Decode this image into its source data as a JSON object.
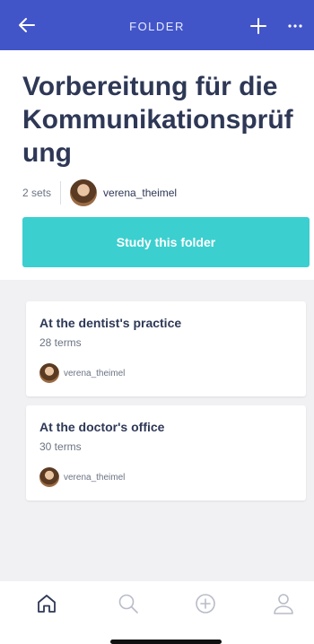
{
  "topbar": {
    "title": "FOLDER",
    "back_icon": "arrow-left-icon",
    "add_icon": "plus-icon",
    "more_icon": "more-horizontal-icon",
    "background": "#4255c8"
  },
  "folder": {
    "title": "Vorbereitung für die Kommunikationsprüfung",
    "sets_count": "2 sets",
    "owner": "verena_theimel",
    "study_button": "Study this folder"
  },
  "sets": [
    {
      "title": "At the dentist's practice",
      "terms": "28 terms",
      "owner": "verena_theimel"
    },
    {
      "title": "At the doctor's office",
      "terms": "30 terms",
      "owner": "verena_theimel"
    }
  ],
  "tabbar": {
    "items": [
      {
        "icon": "home-icon",
        "active": true
      },
      {
        "icon": "search-icon",
        "active": false
      },
      {
        "icon": "plus-circle-icon",
        "active": false
      },
      {
        "icon": "profile-icon",
        "active": false
      }
    ]
  },
  "colors": {
    "accent": "#3ccfcf",
    "text": "#2e3856",
    "muted": "#6b7383",
    "sets_background": "#f1f1f4"
  }
}
